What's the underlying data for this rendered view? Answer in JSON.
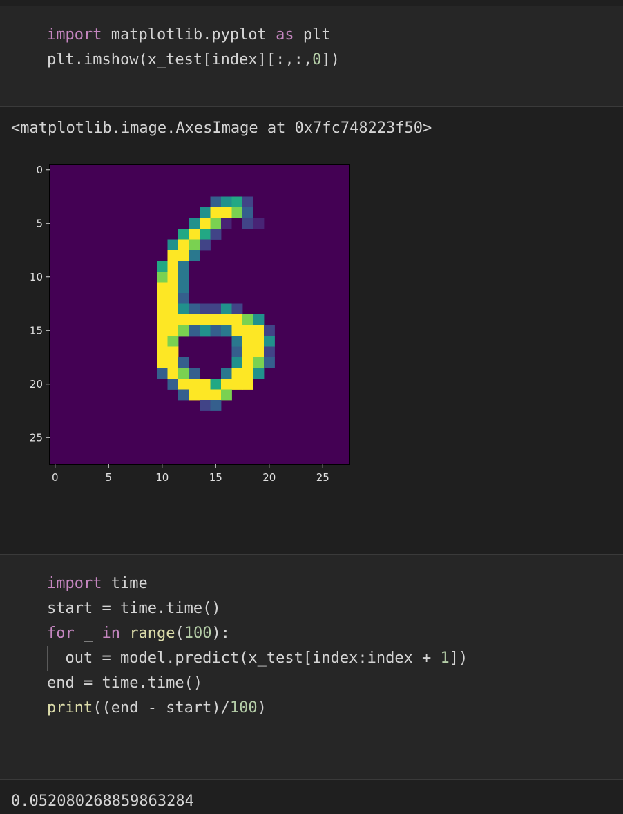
{
  "cell1": {
    "lines": [
      [
        "import",
        " matplotlib.pyplot ",
        "as",
        " plt"
      ],
      [
        "plt.imshow(x_test[index][:,:,",
        "0",
        "])"
      ]
    ]
  },
  "output1": {
    "text": "<matplotlib.image.AxesImage at 0x7fc748223f50>"
  },
  "chart_data": {
    "type": "heatmap",
    "title": "",
    "xlabel": "",
    "ylabel": "",
    "x_ticks": [
      "0",
      "5",
      "10",
      "15",
      "20",
      "25"
    ],
    "y_ticks": [
      "0",
      "5",
      "10",
      "15",
      "20",
      "25"
    ],
    "xlim": [
      -0.5,
      27.5
    ],
    "ylim": [
      27.5,
      -0.5
    ],
    "colormap": "viridis",
    "rows": [
      "............................",
      "............................",
      "............................",
      "...............3562.........",
      "..............59983.........",
      ".............5981021........",
      "............6962............",
      "...........5982.............",
      "...........994..............",
      "..........694...............",
      "..........894...............",
      "..........994...............",
      "..........993...............",
      "..........99532252..........",
      "..........9999999985........",
      "..........99835349992.......",
      "..........98.....4995.......",
      "..........99.....3992.......",
      "..........993....5983.......",
      "..........3983..4995........",
      "...........39996999.........",
      "............39998...........",
      "..............23............",
      "............................",
      "............................",
      "............................",
      "............................",
      "............................"
    ],
    "colors": {
      "bg": "#440154",
      "axis_text": "#e0e0e0",
      "frame": "#000000"
    }
  },
  "cell2": {
    "l1": [
      "import",
      " time"
    ],
    "l2": "start = time.time()",
    "l3": [
      "for",
      " _ ",
      "in",
      " ",
      "range",
      "(",
      "100",
      "):"
    ],
    "l4": [
      "  out = model.predict(x_test[index:index + ",
      "1",
      "])"
    ],
    "l5": "end = time.time()",
    "l6": [
      "print",
      "((end - start)/",
      "100",
      ")"
    ]
  },
  "output2": {
    "text": "0.052080268859863284"
  }
}
